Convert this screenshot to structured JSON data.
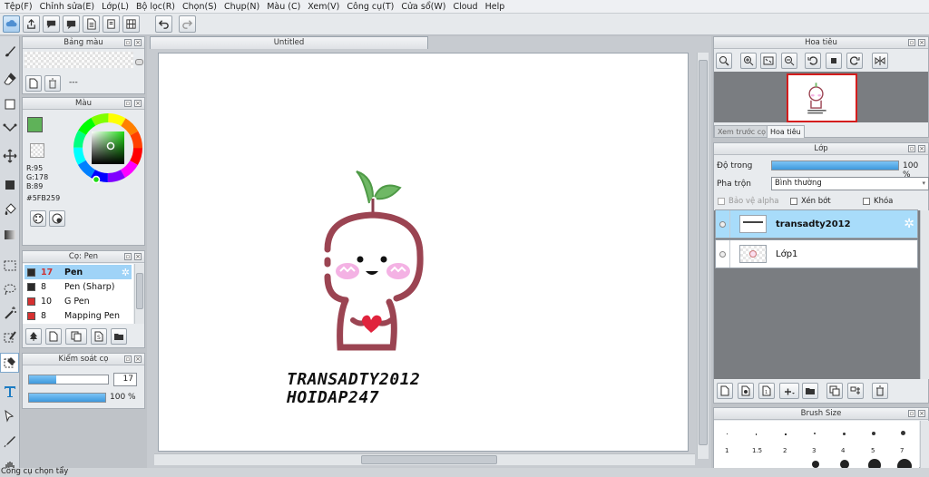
{
  "menu": [
    "Tệp(F)",
    "Chỉnh sửa(E)",
    "Lớp(L)",
    "Bộ lọc(R)",
    "Chọn(S)",
    "Chụp(N)",
    "Màu (C)",
    "Xem(V)",
    "Công cụ(T)",
    "Cửa sổ(W)",
    "Cloud",
    "Help"
  ],
  "document_tab": "Untitled",
  "panels": {
    "brush_color": {
      "title": "Bảng màu",
      "dash": "---"
    },
    "color": {
      "title": "Màu",
      "r": "R:95",
      "g": "G:178",
      "b": "B:89",
      "hex": "#5FB259",
      "current_color": "#5FB259"
    },
    "brush": {
      "title": "Cọ: Pen",
      "items": [
        {
          "size": "17",
          "name": "Pen",
          "color": "#2a2a2a",
          "selected": true
        },
        {
          "size": "8",
          "name": "Pen (Sharp)",
          "color": "#2a2a2a",
          "selected": false
        },
        {
          "size": "10",
          "name": "G Pen",
          "color": "#d63030",
          "selected": false
        },
        {
          "size": "8",
          "name": "Mapping Pen",
          "color": "#d63030",
          "selected": false
        }
      ]
    },
    "brush_control": {
      "title": "Kiểm soát cọ",
      "size_value": "17",
      "size_fraction": 0.35,
      "opacity_value": "100 %",
      "opacity_fraction": 1.0
    },
    "navigator": {
      "title": "Hoa tiêu",
      "tabs": [
        "Xem trước cọ",
        "Hoa tiêu"
      ]
    },
    "layer": {
      "title": "Lớp",
      "opacity_label": "Độ trong",
      "opacity_value": "100 %",
      "opacity_fraction": 1.0,
      "blend_label": "Pha trộn",
      "blend_value": "Bình thường",
      "protect_alpha": "Bảo vệ alpha",
      "clipping": "Xén bớt",
      "lock": "Khóa",
      "layers": [
        "transadty2012",
        "Lớp1"
      ]
    },
    "brush_size": {
      "title": "Brush Size",
      "labels": [
        "1",
        "1.5",
        "2",
        "3",
        "4",
        "5",
        "7"
      ]
    }
  },
  "canvas_text": {
    "line1": "TRANSADTY2012",
    "line2": "HOIDAP247"
  },
  "status": "Công cụ chọn tẩy"
}
